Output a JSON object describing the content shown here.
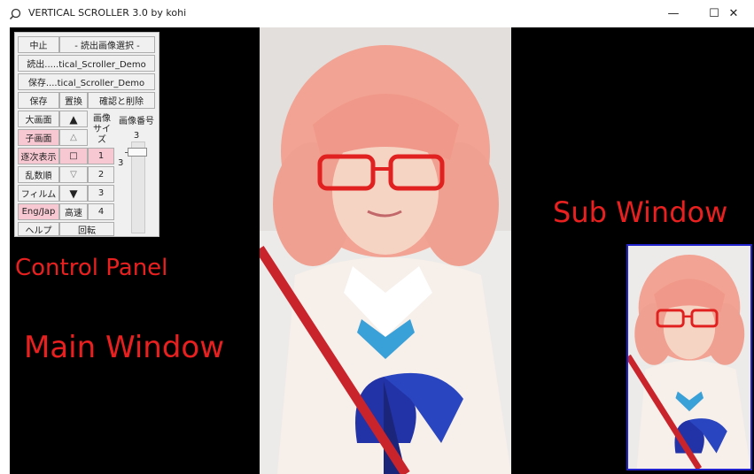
{
  "window": {
    "title": "VERTICAL SCROLLER 3.0 by kohi",
    "controls": {
      "minimize": "—",
      "maximize": "☐",
      "close": "✕"
    }
  },
  "control_panel": {
    "stop": "中止",
    "select_read_image": "- 読出画像選択 -",
    "read": "読出.....tical_Scroller_Demo",
    "save_path": "保存....tical_Scroller_Demo",
    "save": "保存",
    "replace": "置換",
    "confirm_delete": "確認と削除",
    "large_screen": "大画面",
    "up_filled": "▲",
    "image_size": "画像サイズ",
    "image_number": "画像番号",
    "sub_screen": "子画面",
    "up_outline": "△",
    "image_number_value": "3",
    "sequential": "逐次表示",
    "square": "□",
    "size_1": "1",
    "random": "乱数順",
    "down_outline": "▽",
    "size_2": "2",
    "slider_value": "3",
    "film": "フィルム",
    "down_filled": "▼",
    "size_3": "3",
    "eng_jap": "Eng/Jap",
    "fast": "高速",
    "size_4": "4",
    "help": "ヘルプ",
    "rotate": "回転"
  },
  "annotations": {
    "control_panel": "Control Panel",
    "main_window": "Main Window",
    "sub_window": "Sub Window"
  },
  "colors": {
    "annotation": "#e8201f",
    "sub_window_border": "#2222cc",
    "highlight_button": "#f7c8d2",
    "background": "#000000"
  }
}
